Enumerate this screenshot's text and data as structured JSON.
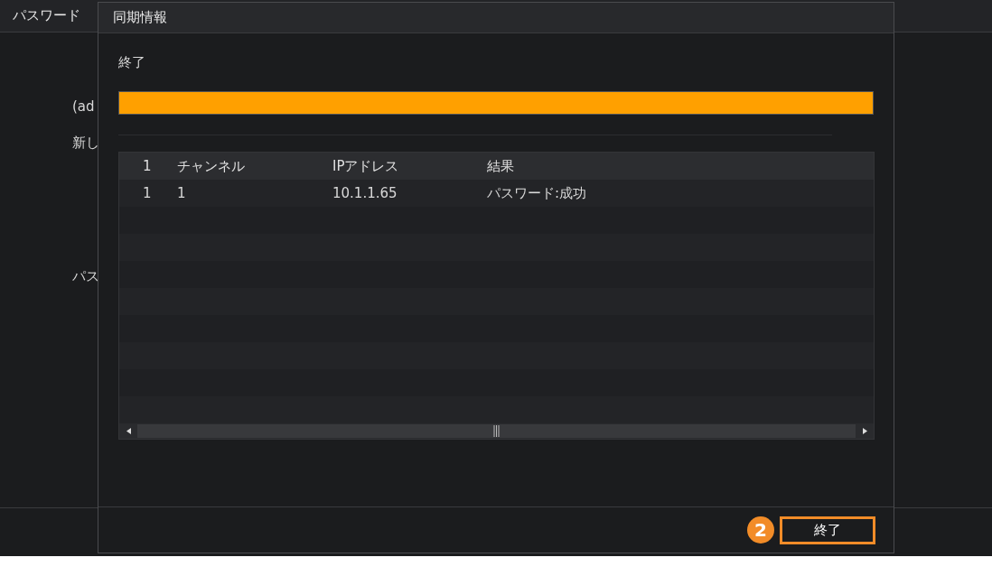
{
  "background_window": {
    "title": "パスワード",
    "labels": [
      "(ad",
      "新し",
      "パス"
    ]
  },
  "dialog": {
    "title": "同期情報",
    "status": "終了",
    "progress": {
      "level": 1
    },
    "table": {
      "columns": [
        "1",
        "チャンネル",
        "IPアドレス",
        "結果"
      ],
      "rows": [
        [
          "1",
          "1",
          "10.1.1.65",
          "パスワード:成功"
        ]
      ]
    },
    "step_badge": "2",
    "finish_button": "終了"
  }
}
